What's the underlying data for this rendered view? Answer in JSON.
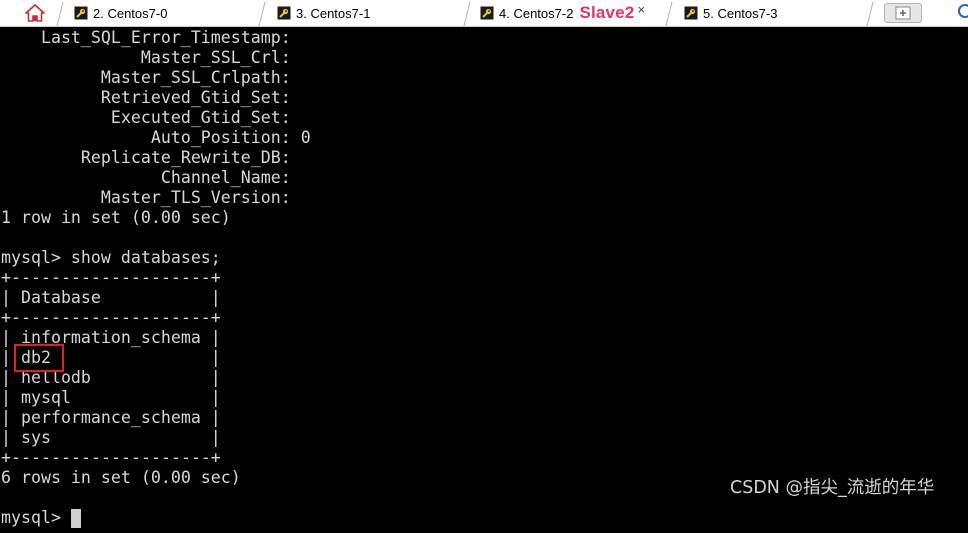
{
  "tabs": [
    {
      "label": "2. Centos7-0",
      "icon": "key-icon"
    },
    {
      "label": "3. Centos7-1",
      "icon": "key-icon"
    },
    {
      "label": "4. Centos7-2",
      "icon": "key-icon",
      "active": true,
      "alias": "Slave2",
      "close": "×"
    },
    {
      "label": "5. Centos7-3",
      "icon": "key-icon"
    }
  ],
  "toolbar": {
    "home_icon": "home-icon",
    "new_tab_icon": "new-tab-icon",
    "search_icon": "search-icon"
  },
  "terminal": {
    "lines": [
      "    Last_SQL_Error_Timestamp: ",
      "              Master_SSL_Crl: ",
      "          Master_SSL_Crlpath: ",
      "          Retrieved_Gtid_Set: ",
      "           Executed_Gtid_Set: ",
      "               Auto_Position: 0",
      "        Replicate_Rewrite_DB: ",
      "                Channel_Name: ",
      "          Master_TLS_Version: ",
      "1 row in set (0.00 sec)",
      "",
      "mysql> show databases;",
      "+--------------------+",
      "| Database           |",
      "+--------------------+",
      "| information_schema |",
      "| db2                |",
      "| hellodb            |",
      "| mysql              |",
      "| performance_schema |",
      "| sys                |",
      "+--------------------+",
      "6 rows in set (0.00 sec)",
      "",
      "mysql> "
    ]
  },
  "watermark": "CSDN @指尖_流逝的年华",
  "colors": {
    "terminal_bg": "#000000",
    "terminal_fg": "#d8d8d8",
    "alias": "#e0346e",
    "highlight": "#e02020"
  }
}
